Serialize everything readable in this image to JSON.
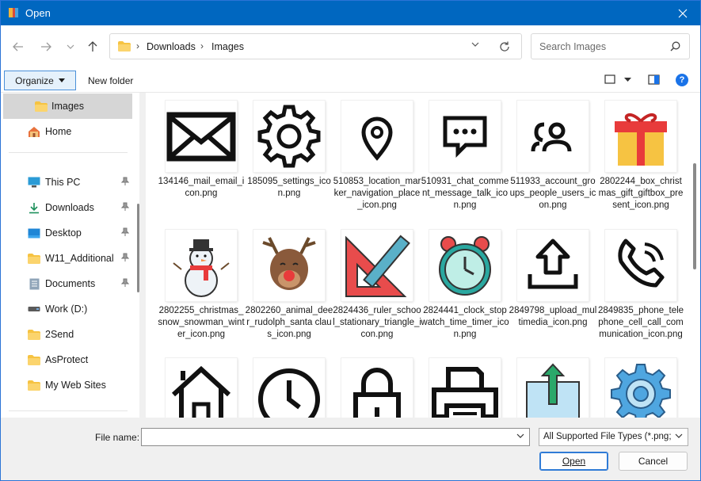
{
  "titlebar": {
    "title": "Open"
  },
  "address": {
    "crumbs": [
      "Downloads",
      "Images"
    ]
  },
  "search": {
    "placeholder": "Search Images"
  },
  "toolbar": {
    "organize_label": "Organize",
    "new_folder_label": "New folder",
    "help_label": "?"
  },
  "sidebar": {
    "items": [
      {
        "label": "Images",
        "icon": "folder-icon",
        "selected": true
      },
      {
        "label": "Home",
        "icon": "home-icon"
      },
      {
        "label": "This PC",
        "icon": "monitor-icon",
        "pinned": true
      },
      {
        "label": "Downloads",
        "icon": "download-icon",
        "pinned": true
      },
      {
        "label": "Desktop",
        "icon": "desktop-icon",
        "pinned": true
      },
      {
        "label": "W11_Additional",
        "icon": "folder-icon",
        "pinned": true
      },
      {
        "label": "Documents",
        "icon": "document-icon",
        "pinned": true
      },
      {
        "label": "Work (D:)",
        "icon": "drive-icon"
      },
      {
        "label": "2Send",
        "icon": "folder-icon"
      },
      {
        "label": "AsProtect",
        "icon": "folder-icon"
      },
      {
        "label": "My Web Sites",
        "icon": "folder-icon"
      }
    ]
  },
  "files": [
    {
      "name": "134146_mail_email_icon.png",
      "icon": "mail-icon"
    },
    {
      "name": "185095_settings_icon.png",
      "icon": "gear-icon"
    },
    {
      "name": "510853_location_marker_navigation_place_icon.png",
      "icon": "location-pin-icon"
    },
    {
      "name": "510931_chat_comment_message_talk_icon.png",
      "icon": "chat-bubble-icon"
    },
    {
      "name": "511933_account_groups_people_users_icon.png",
      "icon": "users-icon"
    },
    {
      "name": "2802244_box_christmas_gift_giftbox_present_icon.png",
      "icon": "gift-box-icon"
    },
    {
      "name": "2802255_christmas_snow_snowman_winter_icon.png",
      "icon": "snowman-icon"
    },
    {
      "name": "2802260_animal_deer_rudolph_santa claus_icon.png",
      "icon": "reindeer-icon"
    },
    {
      "name": "2824436_ruler_school_stationary_triangle_icon.png",
      "icon": "ruler-triangle-icon"
    },
    {
      "name": "2824441_clock_stopwatch_time_timer_icon.png",
      "icon": "alarm-clock-icon"
    },
    {
      "name": "2849798_upload_multimedia_icon.png",
      "icon": "upload-icon"
    },
    {
      "name": "2849835_phone_telephone_cell_call_communication_icon.png",
      "icon": "phone-icon"
    },
    {
      "name": "",
      "icon": "house-icon"
    },
    {
      "name": "",
      "icon": "clock-icon"
    },
    {
      "name": "",
      "icon": "padlock-icon"
    },
    {
      "name": "",
      "icon": "printer-icon"
    },
    {
      "name": "",
      "icon": "upload-box-icon"
    },
    {
      "name": "",
      "icon": "blue-gear-icon"
    }
  ],
  "bottom": {
    "file_name_label": "File name:",
    "file_name_value": "",
    "file_type_value": "All Supported File Types (*.png;",
    "open_label": "Open",
    "cancel_label": "Cancel"
  },
  "colors": {
    "titlebar": "#0067c0",
    "accent": "#1a73e8",
    "folder": "#f6c342"
  }
}
